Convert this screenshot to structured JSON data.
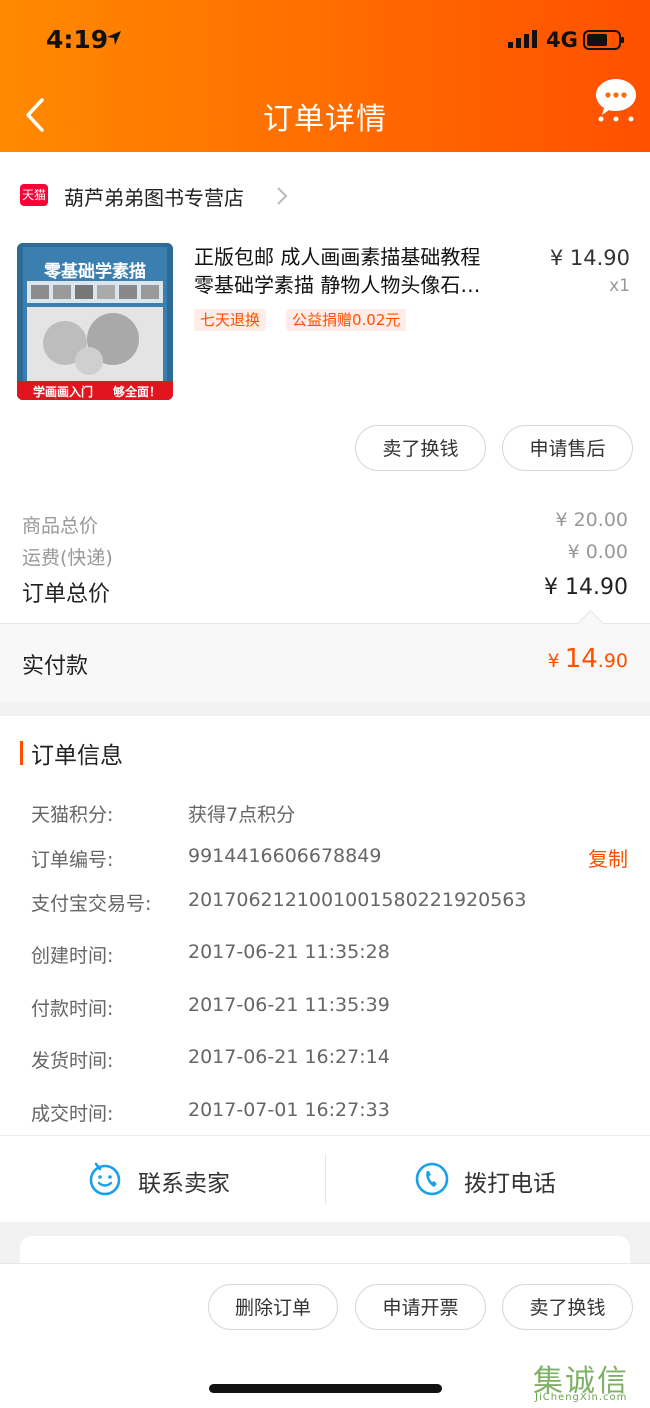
{
  "status_bar": {
    "time": "4:19",
    "network": "4G"
  },
  "nav": {
    "title": "订单详情"
  },
  "store": {
    "badge": "天猫",
    "name": "葫芦弟弟图书专营店"
  },
  "product": {
    "title_line1": "正版包邮 成人画画素描基础教程",
    "title_line2": "零基础学素描 静物人物头像石…",
    "price": "¥ 14.90",
    "qty": "x1",
    "tags": [
      "七天退换",
      "公益捐赠0.02元"
    ],
    "cover_title": "零基础学素描",
    "cover_banner_left": "学画画入门",
    "cover_banner_right": "够全面！"
  },
  "item_actions": [
    "卖了换钱",
    "申请售后"
  ],
  "summary": {
    "goods_label": "商品总价",
    "goods_value": "¥ 20.00",
    "shipping_label": "运费(快递)",
    "shipping_value": "¥ 0.00",
    "total_label": "订单总价",
    "total_value": "¥ 14.90",
    "paid_label": "实付款",
    "paid_currency": "¥",
    "paid_int": "14",
    "paid_dec": ".90"
  },
  "order_info": {
    "title": "订单信息",
    "copy_label": "复制",
    "rows": [
      {
        "label": "天猫积分:",
        "value": "获得7点积分"
      },
      {
        "label": "订单编号:",
        "value": "9914416606678849"
      },
      {
        "label": "支付宝交易号:",
        "value": "2017062121001001580221920563"
      },
      {
        "label": "创建时间:",
        "value": "2017-06-21 11:35:28"
      },
      {
        "label": "付款时间:",
        "value": "2017-06-21 11:35:39"
      },
      {
        "label": "发货时间:",
        "value": "2017-06-21 16:27:14"
      },
      {
        "label": "成交时间:",
        "value": "2017-07-01 16:27:33"
      }
    ]
  },
  "contact": {
    "seller_label": "联系卖家",
    "phone_label": "拨打电话"
  },
  "bottom_actions": [
    "删除订单",
    "申请开票",
    "卖了换钱"
  ],
  "watermark": {
    "main": "集诚信",
    "sub": "JiChengXin.com"
  },
  "colors": {
    "accent": "#ff5000",
    "header_start": "#ff8a00",
    "header_end": "#ff5000",
    "contact_icon": "#1aa0e8"
  }
}
